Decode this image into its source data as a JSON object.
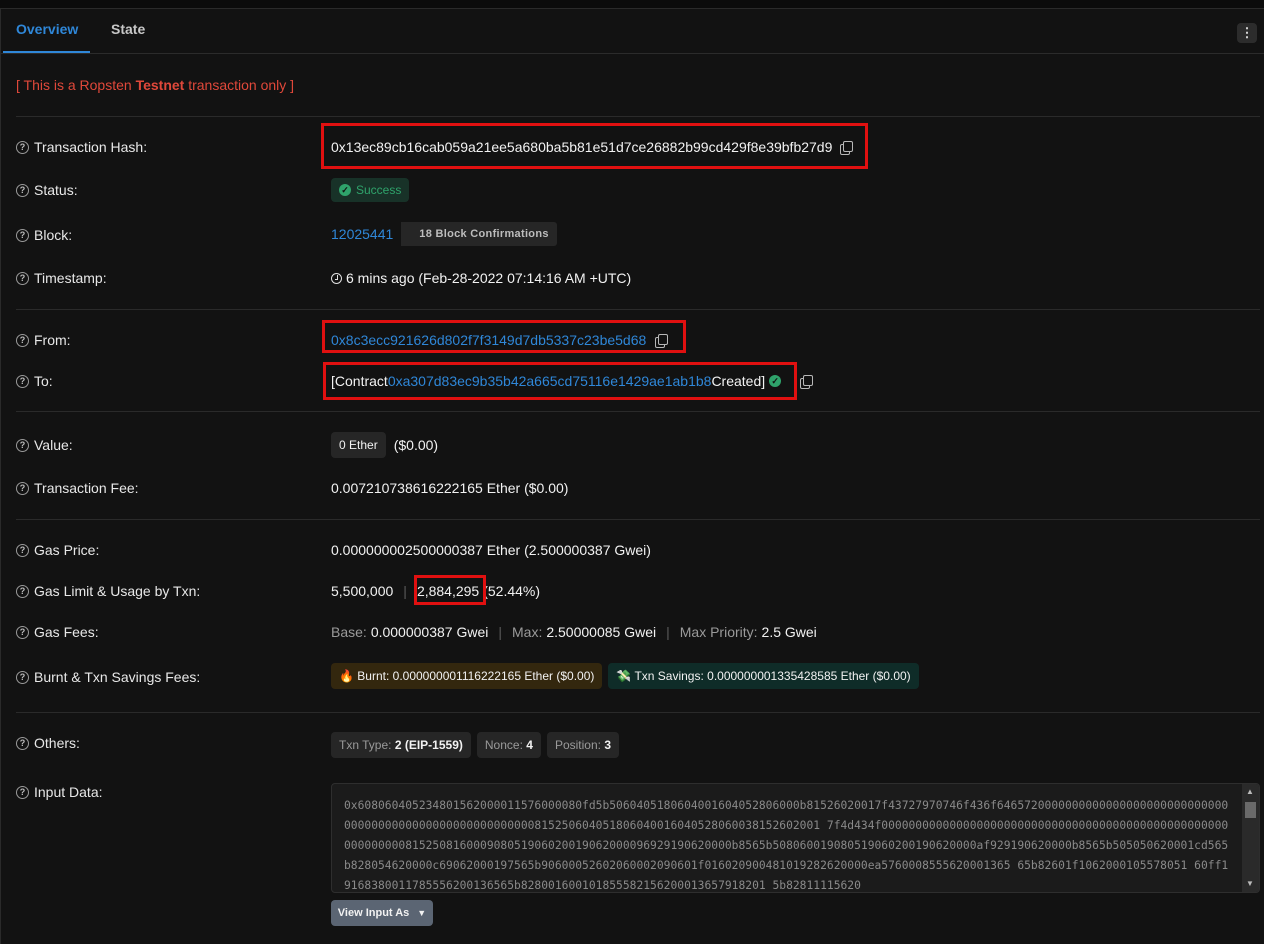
{
  "tabs": [
    {
      "label": "Overview"
    },
    {
      "label": "State"
    }
  ],
  "more_menu": "⋮",
  "notice": {
    "prefix": "[ This is a Ropsten ",
    "bold": "Testnet",
    "suffix": " transaction only ]"
  },
  "rows": {
    "tx_hash": {
      "label": "Transaction Hash:",
      "value": "0x13ec89cb16cab059a21ee5a680ba5b81e51d7ce26882b99cd429f8e39bfb27d9"
    },
    "status": {
      "label": "Status:",
      "value": "Success"
    },
    "block": {
      "label": "Block:",
      "number": "12025441",
      "confirmations": "18 Block Confirmations"
    },
    "timestamp": {
      "label": "Timestamp:",
      "value": "6 mins ago (Feb-28-2022 07:14:16 AM +UTC)"
    },
    "from": {
      "label": "From:",
      "value": "0x8c3ecc921626d802f7f3149d7db5337c23be5d68"
    },
    "to": {
      "label": "To:",
      "prefix": "[Contract ",
      "address": "0xa307d83ec9b35b42a665cd75116e1429ae1ab1b8",
      "suffix": " Created]"
    },
    "value": {
      "label": "Value:",
      "amount": "0 Ether",
      "usd": "($0.00)"
    },
    "tx_fee": {
      "label": "Transaction Fee:",
      "value": "0.007210738616222165 Ether ($0.00)"
    },
    "gas_price": {
      "label": "Gas Price:",
      "value": "0.000000002500000387 Ether (2.500000387 Gwei)"
    },
    "gas_limit": {
      "label": "Gas Limit & Usage by Txn:",
      "limit": "5,500,000",
      "sep": "|",
      "usage": "2,884,295",
      "percent": "(52.44%)"
    },
    "gas_fees": {
      "label": "Gas Fees:",
      "base_label": "Base:",
      "base": "0.000000387 Gwei",
      "max_label": "Max:",
      "max": "2.50000085 Gwei",
      "priority_label": "Max Priority:",
      "priority": "2.5 Gwei",
      "sep": "|"
    },
    "burnt": {
      "label": "Burnt & Txn Savings Fees:",
      "burnt_icon": "🔥",
      "burnt_value": "Burnt: 0.000000001116222165 Ether ($0.00)",
      "savings_icon": "💸",
      "savings_value": "Txn Savings: 0.000000001335428585 Ether ($0.00)"
    },
    "others": {
      "label": "Others:",
      "txn_type_label": "Txn Type:",
      "txn_type": "2 (EIP-1559)",
      "nonce_label": "Nonce:",
      "nonce": "4",
      "position_label": "Position:",
      "position": "3"
    },
    "input": {
      "label": "Input Data:",
      "button": "View Input As",
      "data": "0x608060405234801562000011576000080fd5b5060405180604001604052806000b81526020017f43727970746f436f64657200000000000000000000000000000000000000000000000000000000815250604051806040016040528060038152602001 7f4d434f000000000000000000000000000000000000000000000000000000000000815250816000908051906020019062000096929190620000b8565b508060019080519060200190620000af929190620000b8565b505050620001cd565b828054620000c69062000197565b90600052602060002090601f016020900481019282620000ea5760008555620001365 65b82601f1062000105578051 60ff19168380011785556200136565b828001600101855582156200013657918201 5b82811115620"
    }
  }
}
